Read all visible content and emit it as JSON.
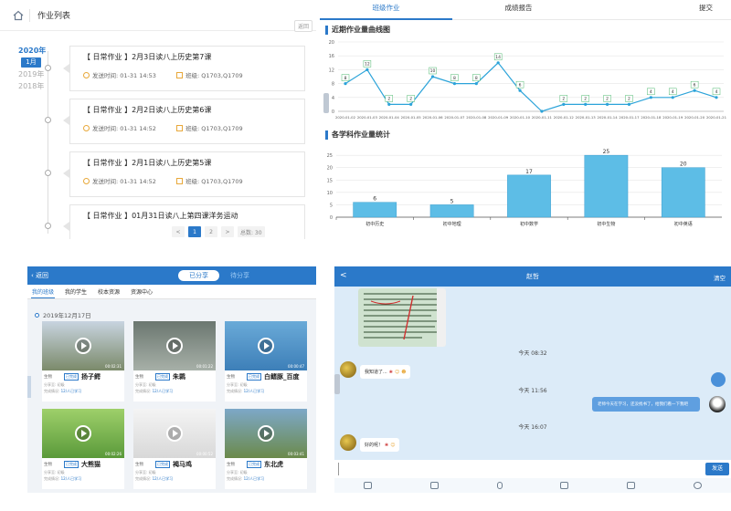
{
  "p1": {
    "title": "作业列表",
    "return_label": "返回",
    "years": [
      "2020年",
      "2019年",
      "2018年"
    ],
    "active_month": "1月",
    "items": [
      {
        "title": "【 日常作业 】2月3日读八上历史第7课",
        "time": "发送时间:  01-31 14:53",
        "class": "班级: Q1703,Q1709"
      },
      {
        "title": "【 日常作业 】2月2日读八上历史第6课",
        "time": "发送时间:  01-31 14:52",
        "class": "班级: Q1703,Q1709"
      },
      {
        "title": "【 日常作业 】2月1日读八上历史第5课",
        "time": "发送时间:  01-31 14:52",
        "class": "班级: Q1703,Q1709"
      },
      {
        "title": "【 日常作业 】01月31日读八上第四课洋务运动",
        "time": "",
        "class": ""
      }
    ],
    "pager": {
      "prev": "<",
      "p1": "1",
      "p2": "2",
      "next": ">",
      "total": "总数: 30"
    }
  },
  "p2": {
    "tabs": [
      "班级作业",
      "成绩报告",
      "提交"
    ],
    "line_title": "近期作业量曲线图",
    "bar_title": "各学科作业量统计"
  },
  "chart_data": [
    {
      "type": "line",
      "title": "近期作业量曲线图",
      "x": [
        "2020-01-02",
        "2020-01-03",
        "2020-01-04",
        "2020-01-05",
        "2020-01-06",
        "2020-01-07",
        "2020-01-08",
        "2020-01-09",
        "2020-01-10",
        "2020-01-11",
        "2020-01-12",
        "2020-01-13",
        "2020-01-14",
        "2020-01-17",
        "2020-01-18",
        "2020-01-19",
        "2020-01-20",
        "2020-01-21"
      ],
      "values": [
        8,
        12,
        2,
        2,
        10,
        8,
        8,
        14,
        6,
        0,
        2,
        2,
        2,
        2,
        4,
        4,
        6,
        4
      ],
      "point_labels": [
        "8",
        "12",
        "2",
        "2",
        "10",
        "8",
        "8",
        "14",
        "6",
        "",
        "2",
        "2",
        "2",
        "2",
        "4",
        "4",
        "6",
        "4"
      ],
      "yticks": [
        0,
        4,
        8,
        12,
        16,
        20
      ],
      "ylim": [
        0,
        20
      ],
      "grid": true,
      "color": "#2ba3d9"
    },
    {
      "type": "bar",
      "title": "各学科作业量统计",
      "categories": [
        "初中历史",
        "初中地理",
        "初中数学",
        "初中生物",
        "初中英语"
      ],
      "values": [
        6,
        5,
        17,
        25,
        20
      ],
      "yticks": [
        0,
        5,
        10,
        15,
        20,
        25
      ],
      "ylim": [
        0,
        28
      ],
      "grid": true,
      "color": "#5dbde6"
    }
  ],
  "p3": {
    "back": "返回",
    "seg_on": "已分享",
    "seg_off": "待分享",
    "nav": [
      "我的班级",
      "我的学生",
      "校本资源",
      "资源中心"
    ],
    "date": "2019年12月17日",
    "videos": [
      {
        "title": "扬子鳄",
        "subject": "生物",
        "duration": "00:02:31",
        "tag": "已完成",
        "sharer": "分享至: 初级",
        "stat": "完成情况:",
        "stat_b": "12/人已学习"
      },
      {
        "title": "朱鹮",
        "subject": "生物",
        "duration": "00:01:22",
        "tag": "已完成",
        "sharer": "分享至: 初级",
        "stat": "完成情况:",
        "stat_b": "12/人已学习"
      },
      {
        "title": "白鳍豚_百度",
        "subject": "生物",
        "duration": "00:00:47",
        "tag": "已完成",
        "sharer": "分享至: 初级",
        "stat": "完成情况:",
        "stat_b": "12/人已学习"
      },
      {
        "title": "大熊猫",
        "subject": "生物",
        "duration": "00:02:26",
        "tag": "已完成",
        "sharer": "分享至: 初级",
        "stat": "完成情况:",
        "stat_b": "12/人已学习"
      },
      {
        "title": "褐马鸡",
        "subject": "生物",
        "duration": "00:00:52",
        "tag": "已完成",
        "sharer": "分享至: 初级",
        "stat": "完成情况:",
        "stat_b": "12/人已学习"
      },
      {
        "title": "东北虎",
        "subject": "生物",
        "duration": "00:03:41",
        "tag": "已完成",
        "sharer": "分享至: 初级",
        "stat": "完成情况:",
        "stat_b": "12/人已学习"
      }
    ]
  },
  "p4": {
    "title": "赵哲",
    "clear": "清空",
    "back": "<",
    "t1": "今天 08:32",
    "m1": "我知道了...",
    "t2": "今天 11:56",
    "m_me": "老师今天在学习，还没找书了，给我们看一下我吧",
    "t3": "今天 16:07",
    "m2": "好的呢！",
    "send": "发送"
  }
}
